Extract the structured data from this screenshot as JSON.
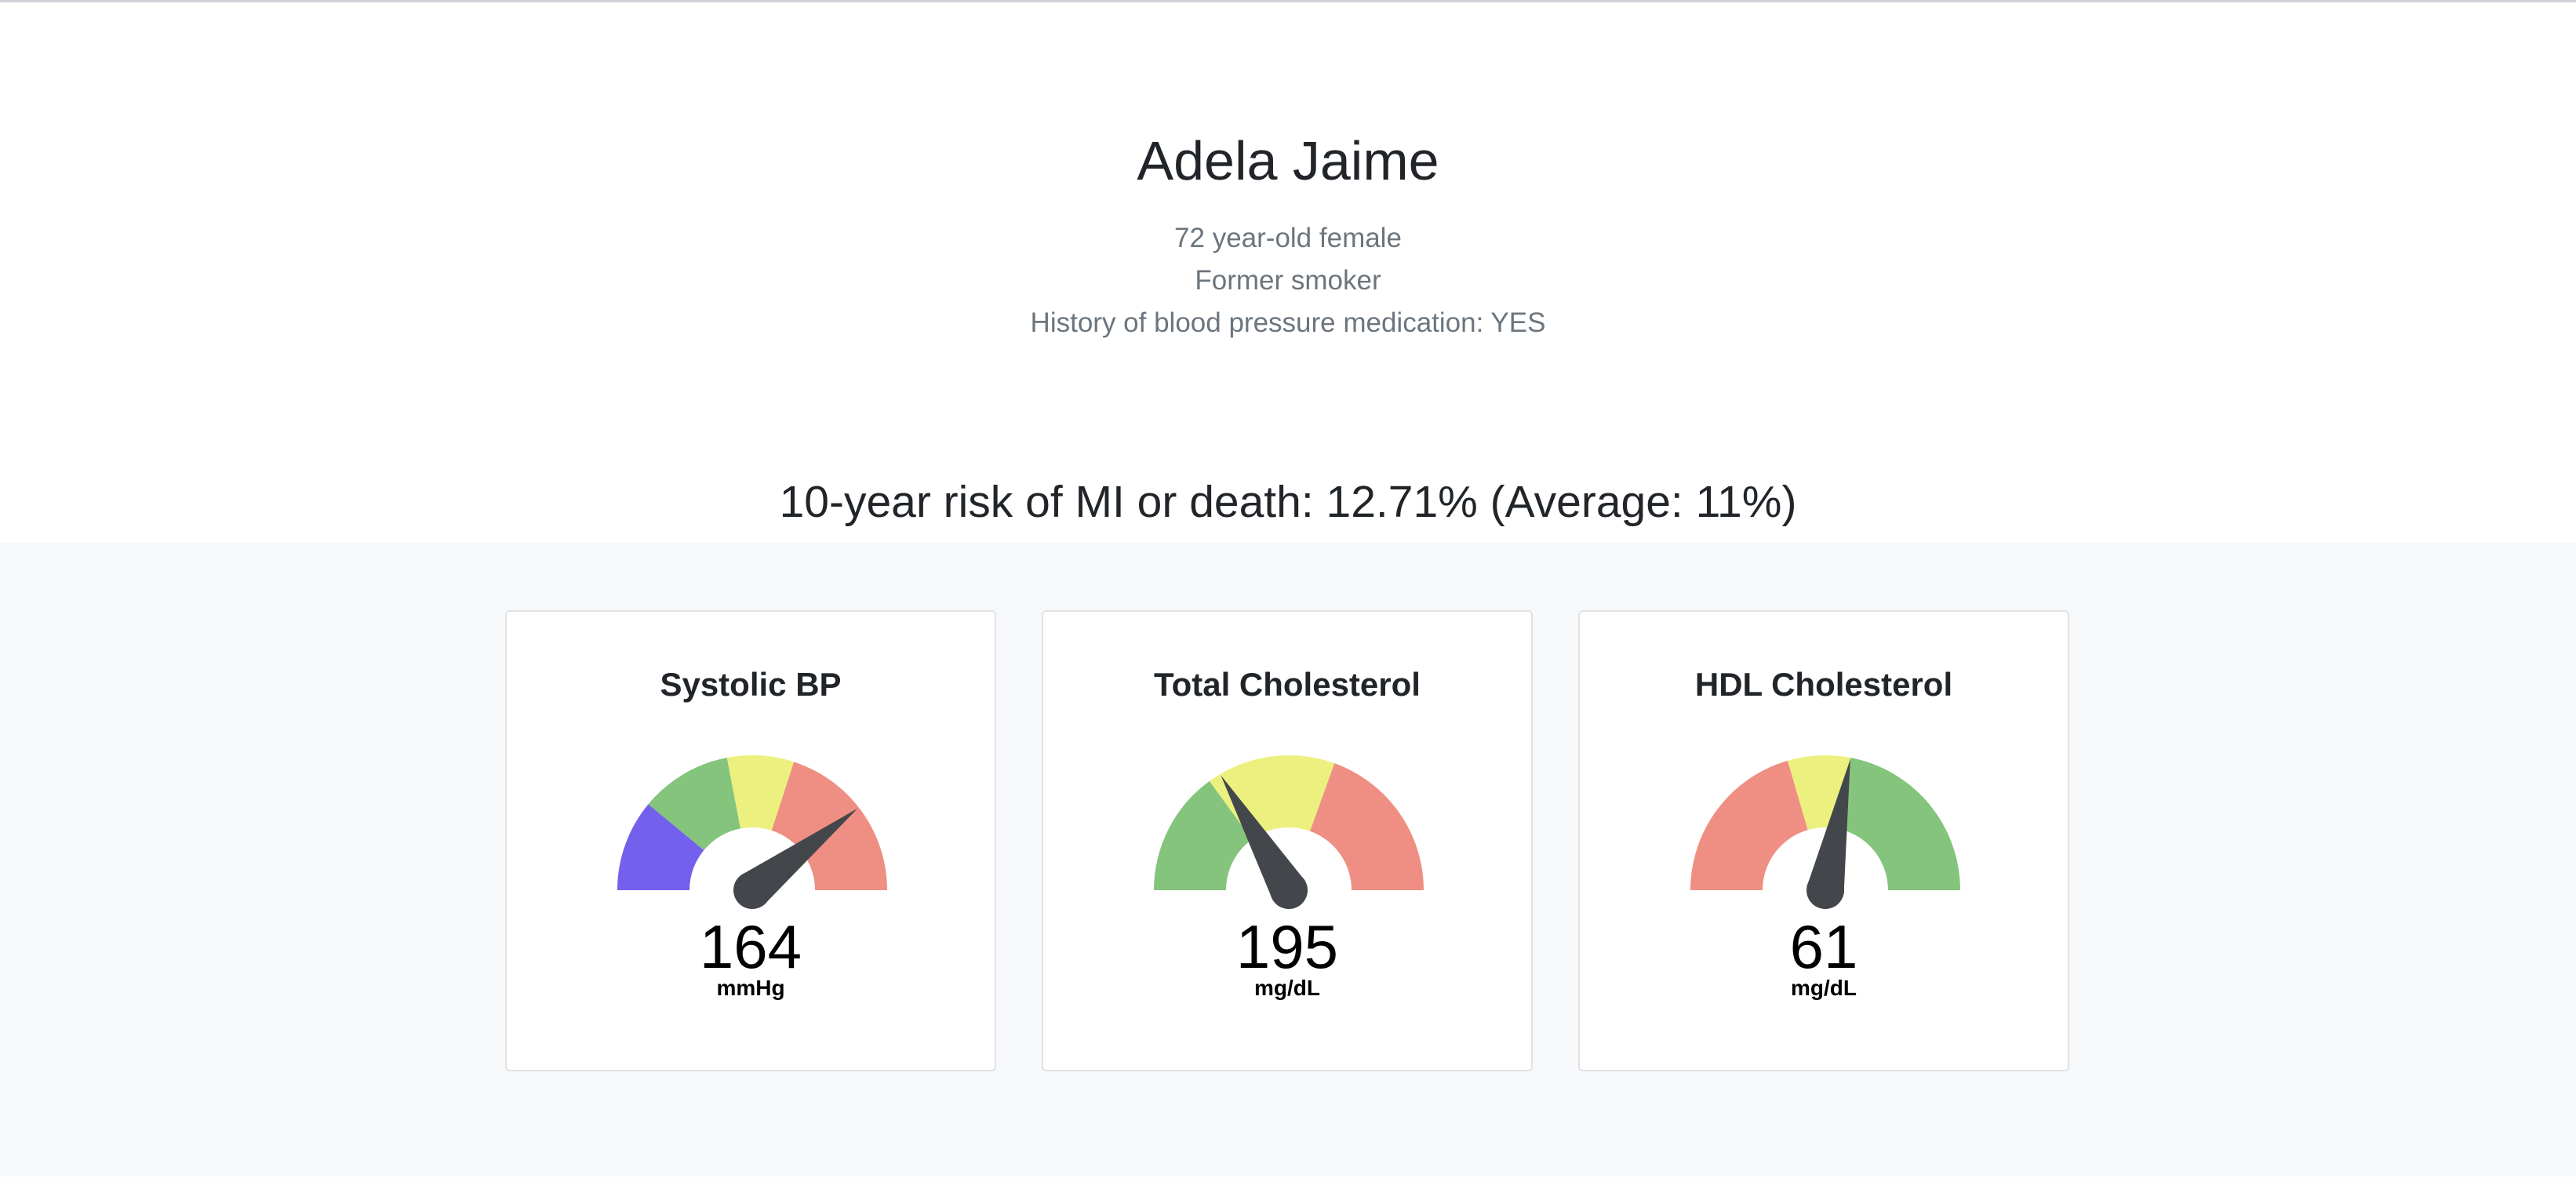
{
  "patient": {
    "name": "Adela Jaime",
    "age_sex": "72 year-old female",
    "smoking": "Former smoker",
    "bp_medication": "History of blood pressure medication: YES"
  },
  "risk": {
    "text": "10-year risk of MI or death: 12.71% (Average: 11%)"
  },
  "colors": {
    "purple": "#7360ec",
    "green": "#84c47c",
    "yellow": "#ecf07f",
    "red": "#ef8f83",
    "needle": "#43474b",
    "band_background": "#f7f8f9"
  },
  "cards": [
    {
      "title": "Systolic BP",
      "value": "164",
      "unit": "mmHg",
      "needle_fraction": 0.79,
      "segments": [
        {
          "color": "purple",
          "fraction": 0.22
        },
        {
          "color": "green",
          "fraction": 0.22
        },
        {
          "color": "yellow",
          "fraction": 0.16
        },
        {
          "color": "red",
          "fraction": 0.4
        }
      ]
    },
    {
      "title": "Total Cholesterol",
      "value": "195",
      "unit": "mg/dL",
      "needle_fraction": 0.33,
      "segments": [
        {
          "color": "green",
          "fraction": 0.3
        },
        {
          "color": "yellow",
          "fraction": 0.31
        },
        {
          "color": "red",
          "fraction": 0.39
        }
      ]
    },
    {
      "title": "HDL Cholesterol",
      "value": "61",
      "unit": "mg/dL",
      "needle_fraction": 0.56,
      "segments": [
        {
          "color": "red",
          "fraction": 0.41
        },
        {
          "color": "yellow",
          "fraction": 0.15
        },
        {
          "color": "green",
          "fraction": 0.44
        }
      ]
    }
  ]
}
